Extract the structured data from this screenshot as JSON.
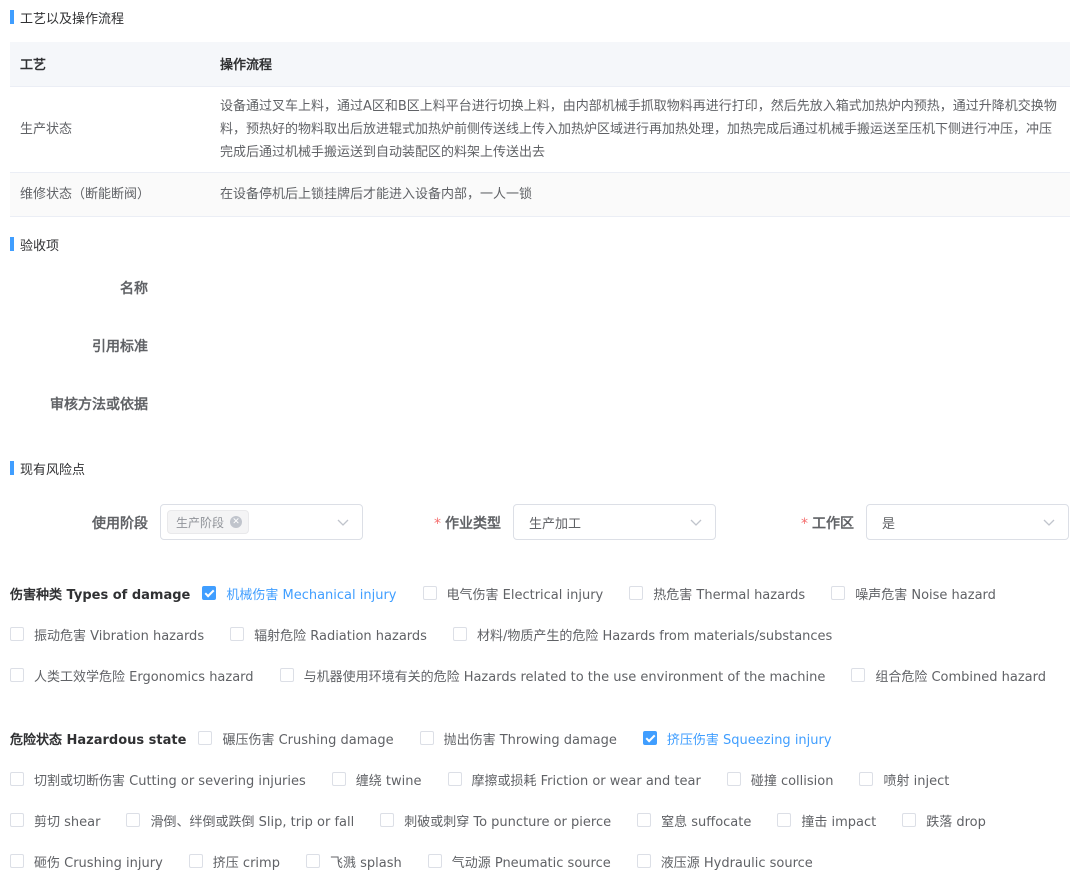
{
  "sections": {
    "process": "工艺以及操作流程",
    "acceptance": "验收项",
    "risk": "现有风险点"
  },
  "process_table": {
    "headers": [
      "工艺",
      "操作流程"
    ],
    "rows": [
      {
        "process": "生产状态",
        "flow": "设备通过叉车上料，通过A区和B区上料平台进行切换上料，由内部机械手抓取物料再进行打印，然后先放入箱式加热炉内预热，通过升降机交换物料，预热好的物料取出后放进辊式加热炉前侧传送线上传入加热炉区域进行再加热处理，加热完成后通过机械手搬运送至压机下侧进行冲压，冲压完成后通过机械手搬运送到自动装配区的料架上传送出去"
      },
      {
        "process": "维修状态（断能断阀）",
        "flow": "在设备停机后上锁挂牌后才能进入设备内部，一人一锁"
      }
    ]
  },
  "acceptance": {
    "name_label": "名称",
    "standard_label": "引用标准",
    "method_label": "审核方法或依据"
  },
  "risk_form": {
    "stage_label": "使用阶段",
    "stage_tag": "生产阶段",
    "job_type_label": "作业类型",
    "job_type_value": "生产加工",
    "work_area_label": "工作区",
    "work_area_value": "是",
    "required_mark": "*"
  },
  "damage": {
    "label": "伤害种类 Types of damage",
    "options": [
      {
        "text": "机械伤害 Mechanical injury",
        "checked": true
      },
      {
        "text": "电气伤害 Electrical injury",
        "checked": false
      },
      {
        "text": "热危害 Thermal hazards",
        "checked": false
      },
      {
        "text": "噪声危害 Noise hazard",
        "checked": false
      },
      {
        "text": "振动危害 Vibration hazards",
        "checked": false
      },
      {
        "text": "辐射危险 Radiation hazards",
        "checked": false
      },
      {
        "text": "材料/物质产生的危险 Hazards from materials/substances",
        "checked": false
      },
      {
        "text": "人类工效学危险 Ergonomics hazard",
        "checked": false
      },
      {
        "text": "与机器使用环境有关的危险 Hazards related to the use environment of the machine",
        "checked": false
      },
      {
        "text": "组合危险 Combined hazard",
        "checked": false
      }
    ]
  },
  "hazard": {
    "label": "危险状态 Hazardous state",
    "options": [
      {
        "text": "碾压伤害 Crushing damage",
        "checked": false
      },
      {
        "text": "抛出伤害 Throwing damage",
        "checked": false
      },
      {
        "text": "挤压伤害 Squeezing injury",
        "checked": true
      },
      {
        "text": "切割或切断伤害 Cutting or severing injuries",
        "checked": false
      },
      {
        "text": "缠绕 twine",
        "checked": false
      },
      {
        "text": "摩擦或损耗 Friction or wear and tear",
        "checked": false
      },
      {
        "text": "碰撞 collision",
        "checked": false
      },
      {
        "text": "喷射 inject",
        "checked": false
      },
      {
        "text": "剪切 shear",
        "checked": false
      },
      {
        "text": "滑倒、绊倒或跌倒 Slip, trip or fall",
        "checked": false
      },
      {
        "text": "刺破或刺穿 To puncture or pierce",
        "checked": false
      },
      {
        "text": "窒息 suffocate",
        "checked": false
      },
      {
        "text": "撞击 impact",
        "checked": false
      },
      {
        "text": "跌落 drop",
        "checked": false
      },
      {
        "text": "砸伤 Crushing injury",
        "checked": false
      },
      {
        "text": "挤压 crimp",
        "checked": false
      },
      {
        "text": "飞溅 splash",
        "checked": false
      },
      {
        "text": "气动源 Pneumatic source",
        "checked": false
      },
      {
        "text": "液压源 Hydraulic source",
        "checked": false
      }
    ]
  },
  "colors": {
    "accent": "#409eff",
    "required": "#f56c6c"
  }
}
